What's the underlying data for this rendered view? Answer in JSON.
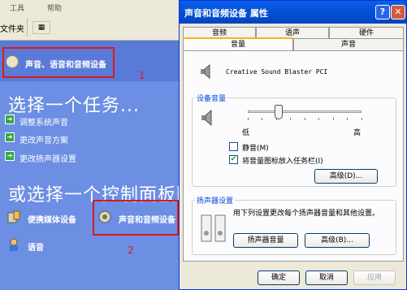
{
  "control_panel": {
    "menubar": {
      "tools": "工具",
      "help": "帮助"
    },
    "toolbar": {
      "folders_label": "文件夹",
      "view_button": "▦"
    },
    "header_item": "声音、语音和音频设备",
    "marker1": "1",
    "task_title": "选择一个任务...",
    "tasks": [
      "调整系统声音",
      "更改声音方案",
      "更改扬声器设置"
    ],
    "panel_title": "或选择一个控制面板图",
    "items": [
      "便携媒体设备",
      "声音和音频设备",
      "语音"
    ],
    "marker2": "2"
  },
  "dialog": {
    "title": "声音和音频设备  属性",
    "help_button": "?",
    "close_button": "✕",
    "tabs_row1": [
      "音频",
      "语声",
      "硬件"
    ],
    "tabs_row2": [
      "音量",
      "声音"
    ],
    "active_tab": "音量",
    "device_name": "Creative Sound Blaster PCI",
    "volume_group": {
      "legend": "设备音量",
      "low_label": "低",
      "high_label": "高",
      "slider_level_percent": 27,
      "mute_label": "静音(M)",
      "mute_checked": false,
      "tray_label": "将音量图标放入任务栏(I)",
      "tray_checked": true,
      "advanced_button": "高级(D)..."
    },
    "speaker_group": {
      "legend": "扬声器设置",
      "description": "用下列设置更改每个扬声器音量和其他设置。",
      "volume_button": "扬声器音量",
      "advanced_button": "高级(B)..."
    },
    "footer": {
      "ok": "确定",
      "cancel": "取消",
      "apply": "应用"
    }
  },
  "colors": {
    "panel_blue": "#6c8ee3",
    "titlebar_blue": "#0553d7",
    "highlight_red": "#d71a1a",
    "dialog_face": "#ece9d8"
  }
}
